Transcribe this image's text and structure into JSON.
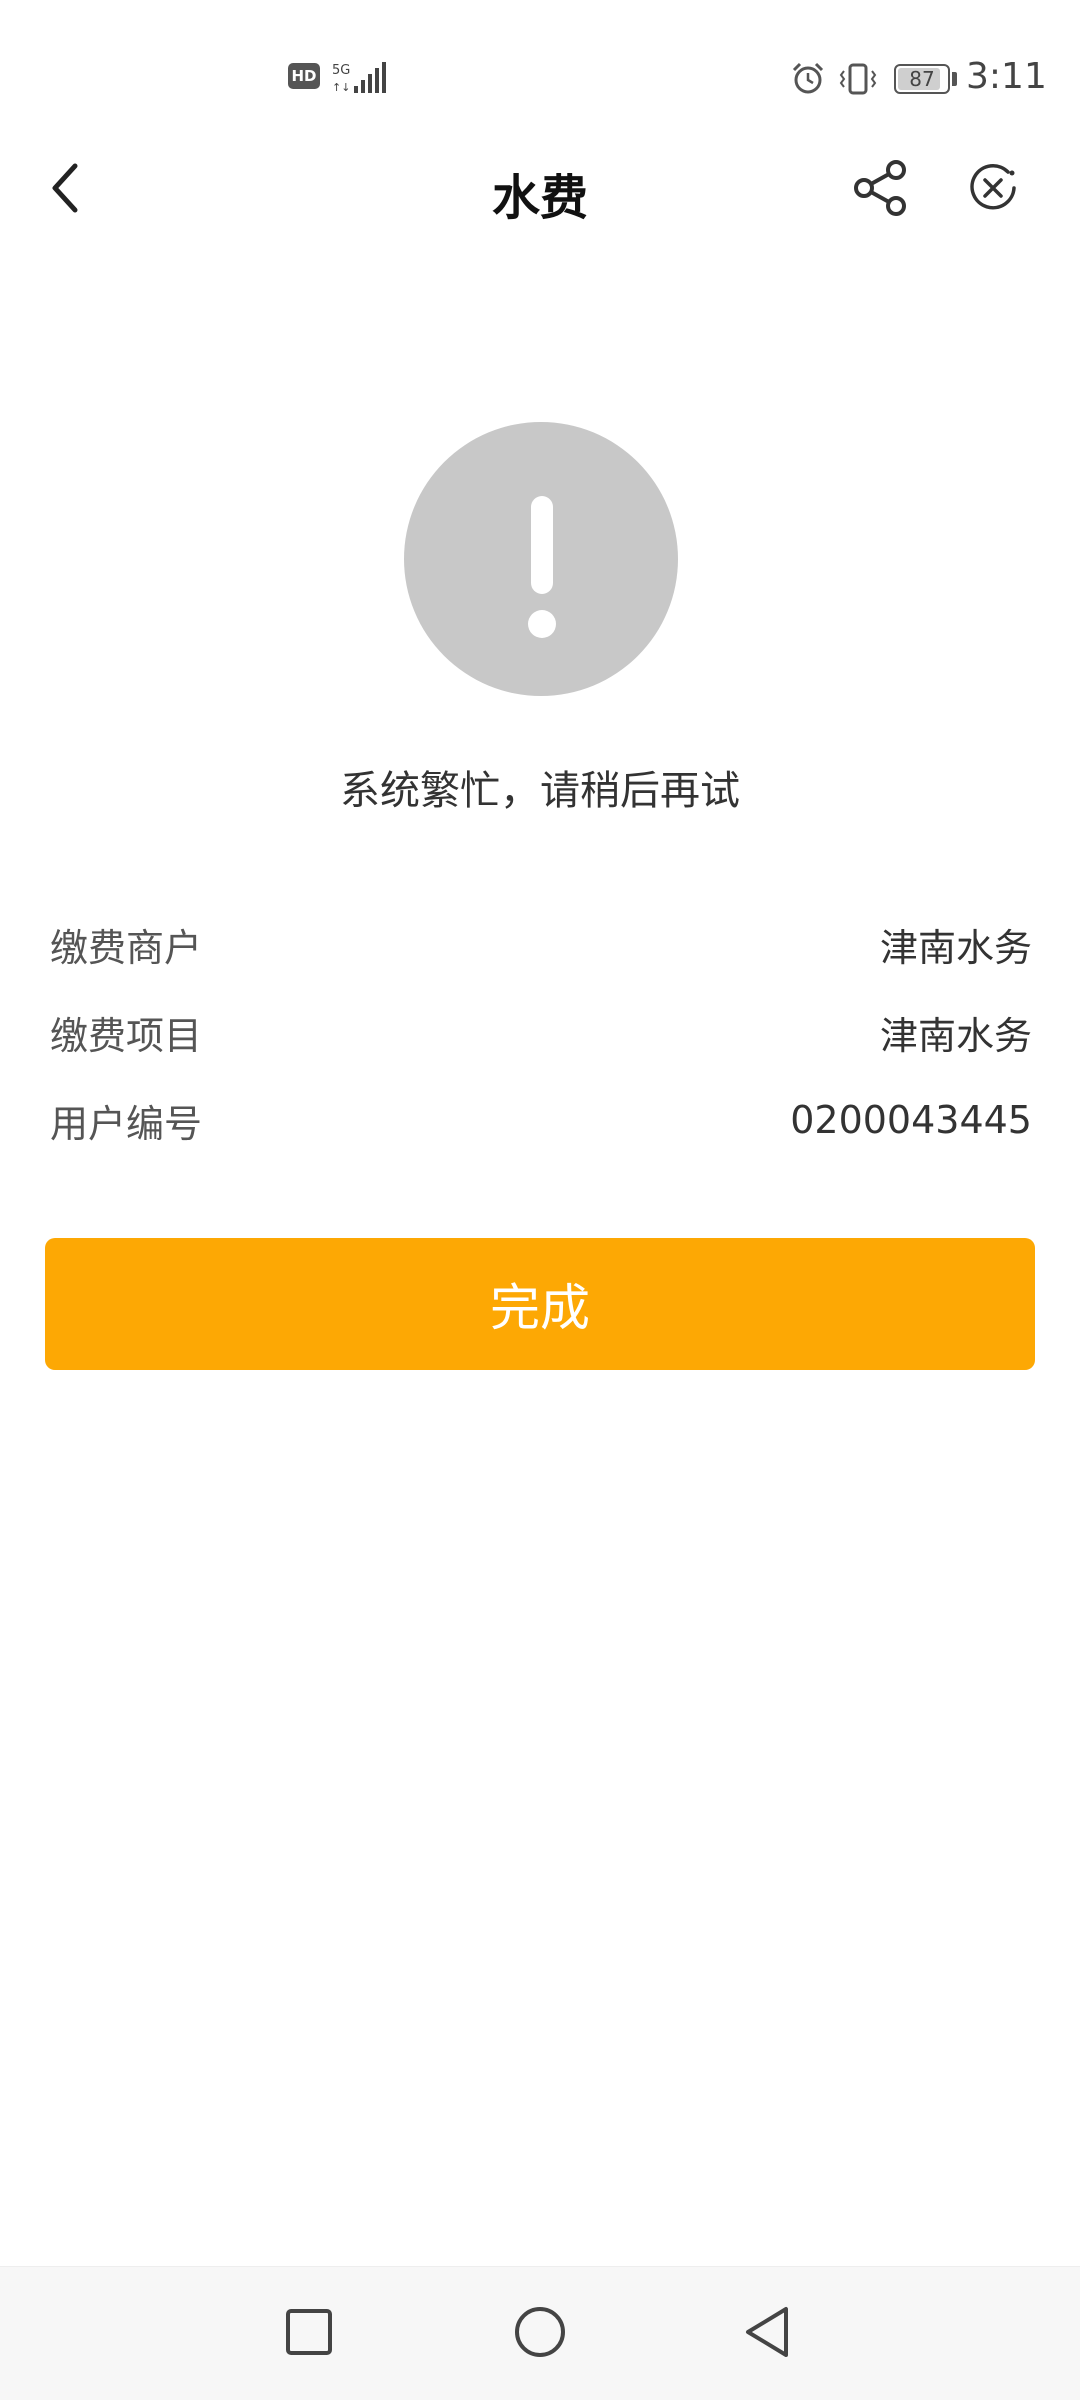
{
  "status_bar": {
    "hd_label": "HD",
    "network_label": "5G",
    "battery": "87",
    "battery_fraction": 0.87,
    "time": "3:11",
    "icons": [
      "signal-icon",
      "alarm-icon",
      "vibrate-icon",
      "battery-icon"
    ]
  },
  "header": {
    "title": "水费",
    "back_icon": "chevron-left-icon",
    "share_icon": "share-icon",
    "close_icon": "close-circle-icon"
  },
  "result": {
    "icon": "exclamation-circle-icon",
    "message": "系统繁忙，请稍后再试"
  },
  "details": [
    {
      "label": "缴费商户",
      "value": "津南水务"
    },
    {
      "label": "缴费项目",
      "value": "津南水务"
    },
    {
      "label": "用户编号",
      "value": "0200043445"
    }
  ],
  "actions": {
    "done_label": "完成"
  },
  "colors": {
    "primary_button": "#fda804",
    "error_circle": "#c8c8c8",
    "background": "#ffffff"
  },
  "nav_bar": {
    "icons": [
      "recent-apps-icon",
      "home-icon",
      "back-triangle-icon"
    ]
  }
}
